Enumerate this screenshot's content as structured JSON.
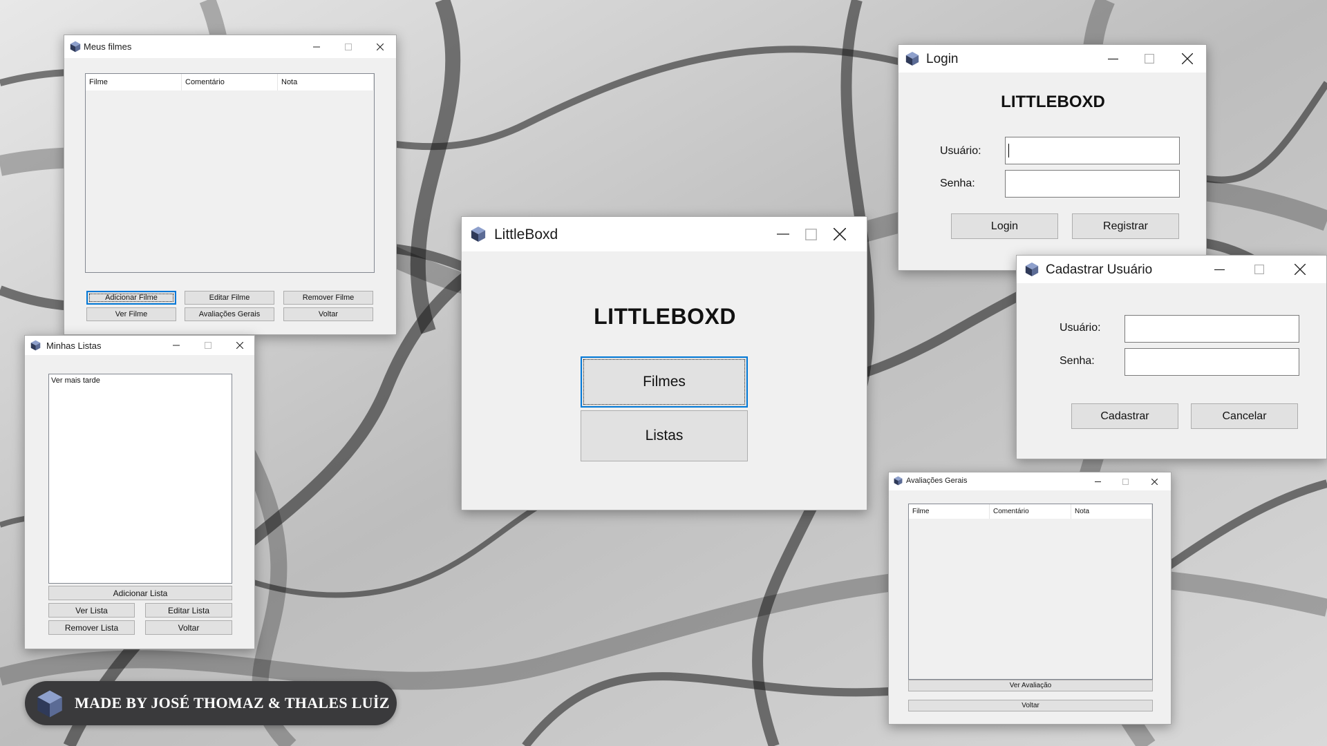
{
  "colors": {
    "window_bg": "#f0f0f0",
    "titlebar_bg": "#ffffff",
    "button_bg": "#e1e1e1",
    "focus_accent": "#0078d7",
    "icon_dark": "#2f3a59",
    "icon_mid": "#5b6b95",
    "icon_light": "#8ea0cc",
    "credits_bg": "#3a3a3c"
  },
  "meus_filmes": {
    "title": "Meus filmes",
    "columns": [
      "Filme",
      "Comentário",
      "Nota"
    ],
    "buttons": {
      "add": "Adicionar Filme",
      "edit": "Editar Filme",
      "remove": "Remover Filme",
      "view": "Ver Filme",
      "general": "Avaliações Gerais",
      "back": "Voltar"
    }
  },
  "minhas_listas": {
    "title": "Minhas Listas",
    "items": [
      "Ver mais tarde"
    ],
    "buttons": {
      "add": "Adicionar Lista",
      "view": "Ver Lista",
      "edit": "Editar Lista",
      "remove": "Remover Lista",
      "back": "Voltar"
    }
  },
  "main": {
    "title": "LittleBoxd",
    "heading": "LITTLEBOXD",
    "buttons": {
      "films": "Filmes",
      "lists": "Listas"
    }
  },
  "login": {
    "title": "Login",
    "heading": "LITTLEBOXD",
    "user_label": "Usuário:",
    "pass_label": "Senha:",
    "buttons": {
      "login": "Login",
      "register": "Registrar"
    }
  },
  "register": {
    "title": "Cadastrar Usuário",
    "user_label": "Usuário:",
    "pass_label": "Senha:",
    "buttons": {
      "submit": "Cadastrar",
      "cancel": "Cancelar"
    }
  },
  "avaliacoes": {
    "title": "Avaliações Gerais",
    "columns": [
      "Filme",
      "Comentário",
      "Nota"
    ],
    "buttons": {
      "view": "Ver Avaliação",
      "back": "Voltar"
    }
  },
  "credits": {
    "text": "MADE BY JOSÉ THOMAZ & THALES LUİZ"
  }
}
